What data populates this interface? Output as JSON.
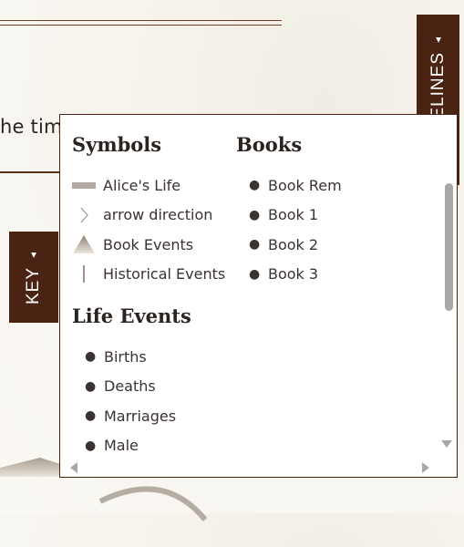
{
  "background": {
    "partial_text": "he tim"
  },
  "guidelines_tab": {
    "label": "GUIDELINES",
    "arrow": "▲"
  },
  "key_tab": {
    "label": "KEY",
    "arrow": "▲"
  },
  "key_panel": {
    "symbols": {
      "heading": "Symbols",
      "items": [
        {
          "label": "Alice's Life",
          "icon": "bar-icon"
        },
        {
          "label": "arrow direction",
          "icon": "chevron-right-icon"
        },
        {
          "label": "Book Events",
          "icon": "triangle-icon"
        },
        {
          "label": "Historical Events",
          "icon": "vertical-line-icon"
        }
      ]
    },
    "books": {
      "heading": "Books",
      "items": [
        "Book Rem",
        "Book 1",
        "Book 2",
        "Book 3"
      ]
    },
    "life_events": {
      "heading": "Life Events",
      "items": [
        "Births",
        "Deaths",
        "Marriages",
        "Male"
      ]
    }
  },
  "colors": {
    "tab_bg": "#4a2312",
    "panel_border": "#4a2312",
    "bar_symbol": "#b1aaa2",
    "accent_line": "#7a3e22"
  }
}
